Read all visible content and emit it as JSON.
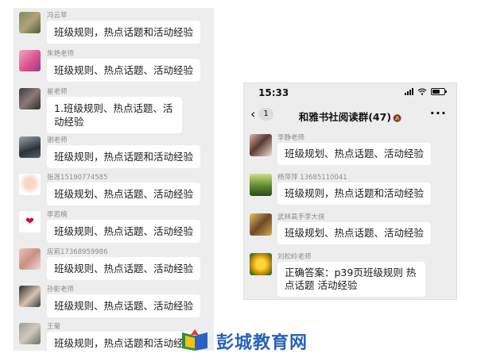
{
  "left_chat": {
    "messages": [
      {
        "sender": "冯云苹",
        "text": "班级规则，热点话题和活动经验"
      },
      {
        "sender": "朱艳老师",
        "text": "班级规则、热点话题、活动经验"
      },
      {
        "sender": "崔老师",
        "text": "1.班级规则、热点话题、活动经验"
      },
      {
        "sender": "谢老师",
        "text": "班级规则，热点话题和活动经验"
      },
      {
        "sender": "张莲15190774585",
        "text": "班级规划、热点话题、活动经验"
      },
      {
        "sender": "李若楠",
        "text": "班级规则、热点话题、活动经验"
      },
      {
        "sender": "房莉17368959986",
        "text": "班级规则、热点话题、活动经验"
      },
      {
        "sender": "孙影老师",
        "text": "班级规则、热点话题、活动经验"
      },
      {
        "sender": "王菊",
        "text": "班级规则，热点话题和活动经验"
      }
    ]
  },
  "phone": {
    "status": {
      "time": "15:33"
    },
    "nav": {
      "back_chevron": "‹",
      "back_badge": "1",
      "title": "和雅书社阅读群(47)",
      "more": "···"
    },
    "messages": [
      {
        "sender": "李静老师",
        "text": "班级规划、热点话题、活动经验"
      },
      {
        "sender": "杨萍萍 13685110041",
        "text": "班级规则，热点话题和活动经验"
      },
      {
        "sender": "武林高手李大侠",
        "text": "班级规划、热点话题、活动经验"
      },
      {
        "sender": "刘松岭老师",
        "text": "正确答案：p39页班级规则 热点话题 活动经验"
      }
    ]
  },
  "watermark": {
    "text": "彭城教育网"
  },
  "colors": {
    "chat_bg": "#ededed",
    "bubble_bg": "#ffffff",
    "watermark_blue": "#2862b8"
  },
  "icons": [
    "chevron-left-icon",
    "mute-bell-icon",
    "more-icon",
    "signal-icon",
    "wifi-icon",
    "battery-icon"
  ]
}
